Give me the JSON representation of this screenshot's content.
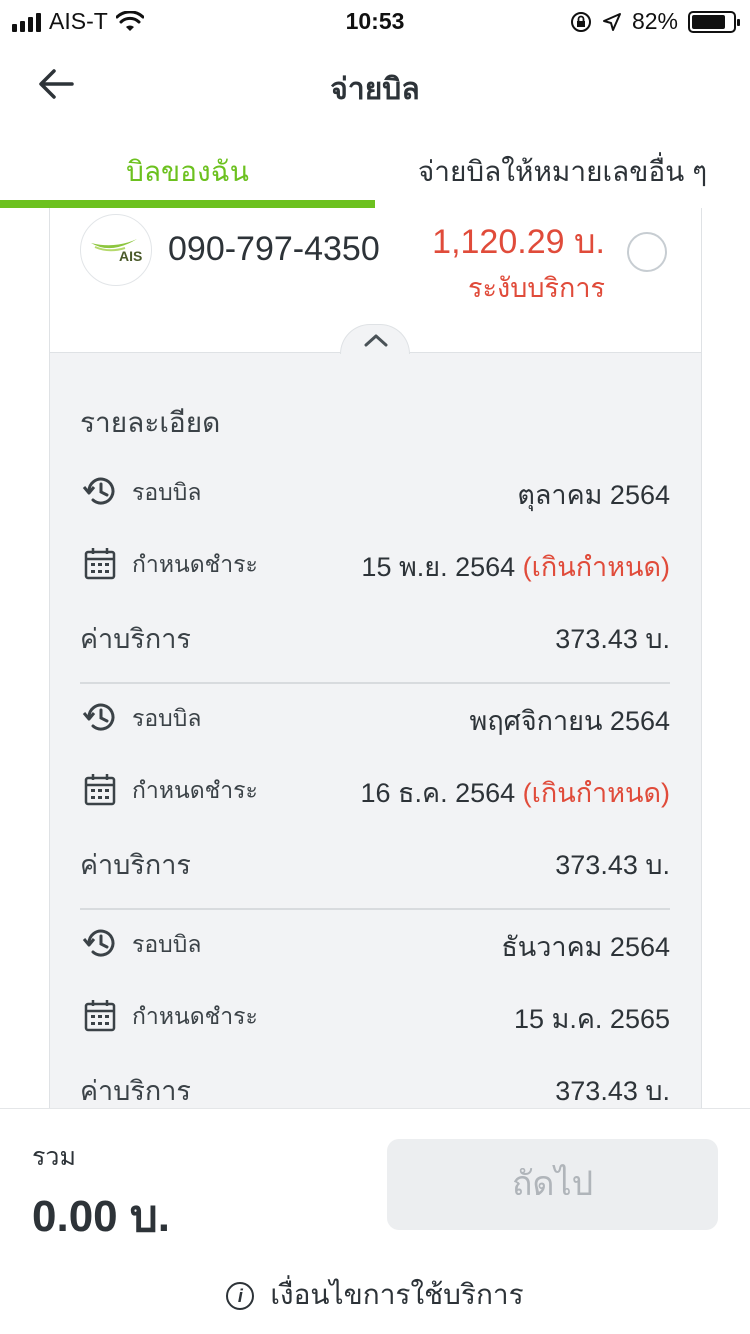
{
  "status_bar": {
    "carrier": "AIS-T",
    "time": "10:53",
    "battery": "82%",
    "battery_level": 0.82
  },
  "header": {
    "title": "จ่ายบิล"
  },
  "tabs": [
    {
      "label": "บิลของฉัน",
      "active": true
    },
    {
      "label": "จ่ายบิลให้หมายเลขอื่น ๆ",
      "active": false
    }
  ],
  "account": {
    "logo_text": "AIS",
    "phone": "090-797-4350",
    "amount": "1,120.29 บ.",
    "status": "ระงับบริการ"
  },
  "details": {
    "title": "รายละเอียด",
    "bills": [
      {
        "cycle_label": "รอบบิล",
        "cycle_value": "ตุลาคม 2564",
        "due_label": "กำหนดชำระ",
        "due_value": "15 พ.ย. 2564",
        "overdue_text": "(เกินกำหนด)",
        "fee_label": "ค่าบริการ",
        "fee_value": "373.43 บ."
      },
      {
        "cycle_label": "รอบบิล",
        "cycle_value": "พฤศจิกายน 2564",
        "due_label": "กำหนดชำระ",
        "due_value": "16 ธ.ค. 2564",
        "overdue_text": "(เกินกำหนด)",
        "fee_label": "ค่าบริการ",
        "fee_value": "373.43 บ."
      },
      {
        "cycle_label": "รอบบิล",
        "cycle_value": "ธันวาคม 2564",
        "due_label": "กำหนดชำระ",
        "due_value": "15 ม.ค. 2565",
        "overdue_text": "",
        "fee_label": "ค่าบริการ",
        "fee_value": "373.43 บ."
      }
    ]
  },
  "footer": {
    "total_label": "รวม",
    "total_value": "0.00 บ.",
    "next_button": "ถัดไป",
    "terms": "เงื่อนไขการใช้บริการ"
  },
  "colors": {
    "accent_green": "#6cc11f",
    "alert_red": "#e04b3a",
    "text_dark": "#2d3338",
    "detail_bg": "#f2f3f5"
  }
}
